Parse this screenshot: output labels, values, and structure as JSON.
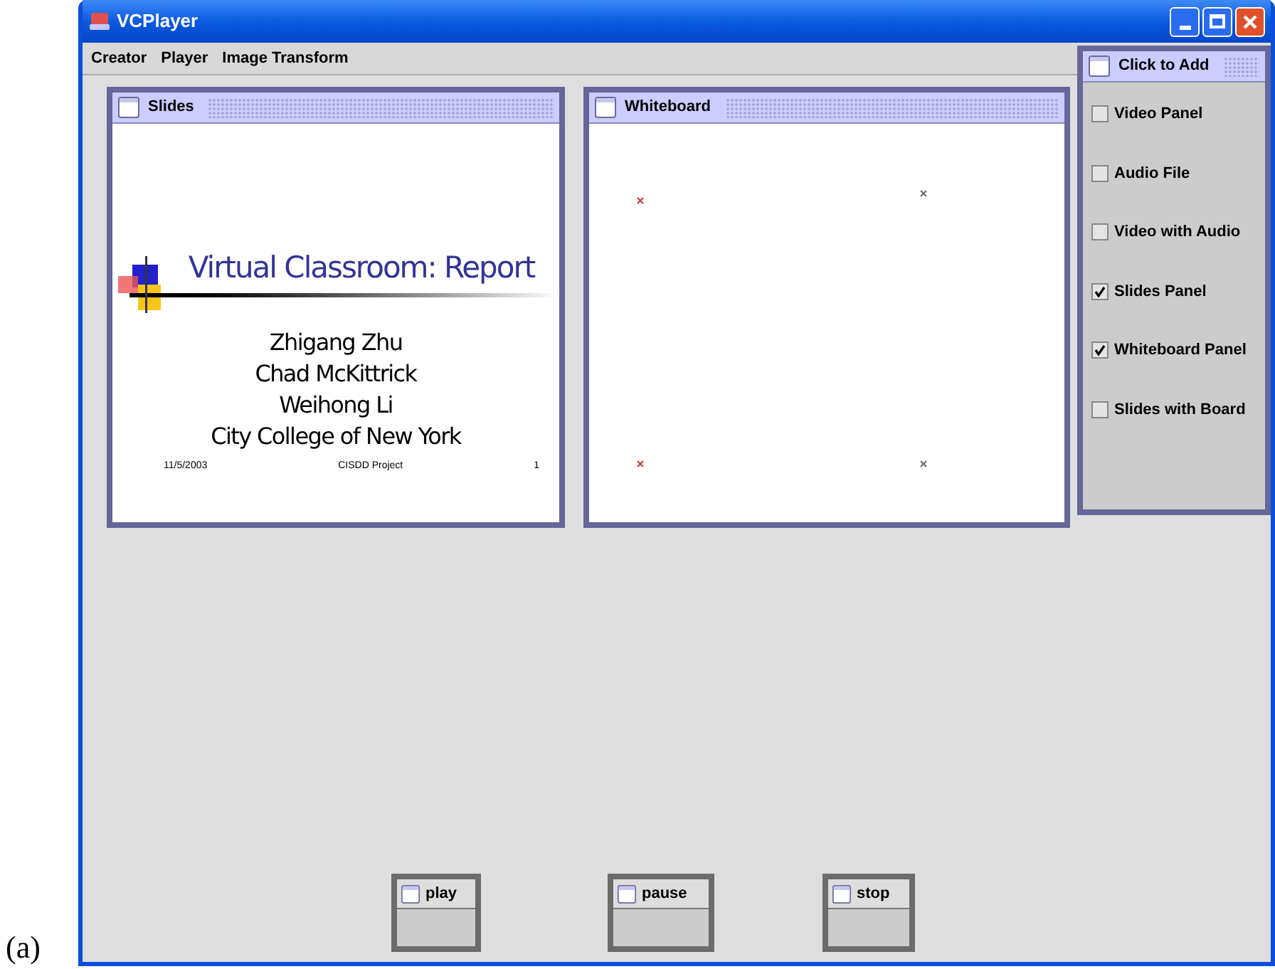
{
  "figure_label": "(a)",
  "window": {
    "title": "VCPlayer"
  },
  "menu": [
    "Creator",
    "Player",
    "Image Transform"
  ],
  "slides_frame": {
    "title": "Slides",
    "slide": {
      "title": "Virtual Classroom: Report",
      "authors": [
        "Zhigang Zhu",
        "Chad McKittrick",
        "Weihong Li",
        "City College of New York"
      ],
      "footer_date": "11/5/2003",
      "footer_center": "CISDD Project",
      "page": "1"
    }
  },
  "whiteboard_frame": {
    "title": "Whiteboard"
  },
  "add_panel": {
    "title": "Click to Add",
    "options": [
      {
        "label": "Video Panel",
        "checked": false
      },
      {
        "label": "Audio File",
        "checked": false
      },
      {
        "label": "Video with Audio",
        "checked": false
      },
      {
        "label": "Slides Panel",
        "checked": true
      },
      {
        "label": "Whiteboard Panel",
        "checked": true
      },
      {
        "label": "Slides with Board",
        "checked": false
      }
    ]
  },
  "controls": [
    {
      "title": "play"
    },
    {
      "title": "pause"
    },
    {
      "title": "stop"
    }
  ]
}
